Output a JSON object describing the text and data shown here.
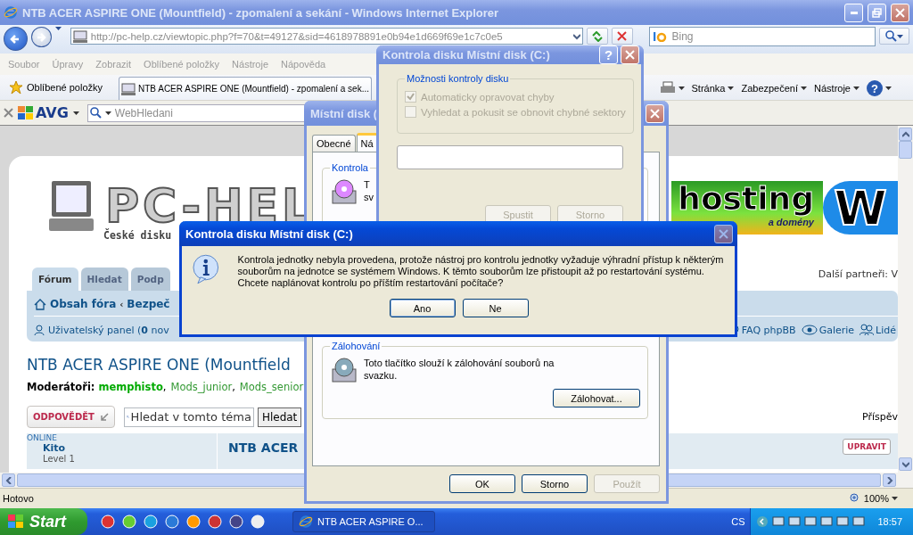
{
  "browser": {
    "title": "NTB ACER ASPIRE ONE (Mountfield) - zpomalení a sekání - Windows Internet Explorer",
    "address": "http://pc-help.cz/viewtopic.php?f=70&t=49127&sid=4618978891e0b94e1d669f69e1c7c0e5",
    "search_placeholder": "Bing",
    "menu": [
      "Soubor",
      "Úpravy",
      "Zobrazit",
      "Oblíbené položky",
      "Nástroje",
      "Nápověda"
    ],
    "favorites": "Oblíbené položky",
    "tab": "NTB ACER ASPIRE ONE (Mountfield) - zpomalení a sek...",
    "commands": [
      "Stránka",
      "Zabezpečení",
      "Nástroje"
    ],
    "help_label": "?",
    "toolbar": {
      "logo": "AVG",
      "search_placeholder": "WebHledani"
    },
    "status": "Hotovo",
    "zoom": "100%"
  },
  "page": {
    "logo": "PC-HEL",
    "tagline": "České disku",
    "banner": {
      "headline": "hosting",
      "sub": "a domény",
      "letter": "W"
    },
    "partners": "Další partneři: V",
    "tabs": [
      {
        "label": "Fórum",
        "selected": true
      },
      {
        "label": "Hledat",
        "selected": false
      },
      {
        "label": "Podp",
        "selected": false
      }
    ],
    "breadcrumb": [
      "Obsah fóra",
      "Bezpeč"
    ],
    "breadcrumb_separator": "‹",
    "user_panel": "Uživatelský panel (**0** nov",
    "links": [
      "FAQ phpBB",
      "Galerie",
      "Lidé"
    ],
    "topic_title": "NTB ACER ASPIRE ONE (Mountfield",
    "moderators_label": "Moderátoři:",
    "moderator_separator": ",",
    "moderators": [
      {
        "name": "memphisto",
        "kind": "user"
      },
      {
        "name": "Mods_junior",
        "kind": "group"
      },
      {
        "name": "Mods_senior",
        "kind": "group"
      }
    ],
    "reply_button": "ODPOVĚDĚT",
    "search_placeholder": "Hledat v tomto téma",
    "search_button": "Hledat",
    "posts_count": "Příspěv",
    "post": {
      "status": "ONLINE",
      "author": "Kito",
      "rank": "Level 1",
      "title": "NTB ACER",
      "edit": "UPRAVIT"
    }
  },
  "properties": {
    "title": "Místní disk (",
    "tabs": [
      {
        "label": "Obecné",
        "selected": false
      },
      {
        "label": "Ná",
        "selected": true
      }
    ],
    "check_group": "Kontrola",
    "check_text": [
      "T",
      "sv"
    ],
    "backup_group": "Zálohování",
    "backup_text": "Toto tlačítko slouží k zálohování souborů na svazku.",
    "backup_button": "Zálohovat...",
    "buttons": [
      {
        "label": "OK",
        "disabled": false
      },
      {
        "label": "Storno",
        "disabled": false
      },
      {
        "label": "Použít",
        "disabled": true
      }
    ]
  },
  "check_disk": {
    "title": "Kontrola disku Místní disk (C:)",
    "help_label": "?",
    "group": "Možnosti kontroly disku",
    "options": [
      {
        "label": "Automaticky opravovat chyby",
        "checked": true,
        "disabled": true
      },
      {
        "label": "Vyhledat a pokusit se obnovit chybné sektory",
        "checked": false,
        "disabled": true
      }
    ],
    "progress": {
      "level": 0
    },
    "buttons": [
      {
        "label": "Spustit",
        "disabled": true
      },
      {
        "label": "Storno",
        "disabled": true
      }
    ]
  },
  "message": {
    "title": "Kontrola disku Místní disk (C:)",
    "text": "Kontrola jednotky nebyla provedena, protože nástroj pro kontrolu jednotky vyžaduje výhradní přístup k některým souborům na jednotce se systémem Windows. K těmto souborům lze přistoupit až po restartování systému. Chcete naplánovat kontrolu po příštím restartování počítače?",
    "buttons": [
      "Ano",
      "Ne"
    ]
  },
  "taskbar": {
    "start": "Start",
    "task": "NTB ACER ASPIRE O...",
    "language": "CS",
    "clock": "18:57"
  }
}
